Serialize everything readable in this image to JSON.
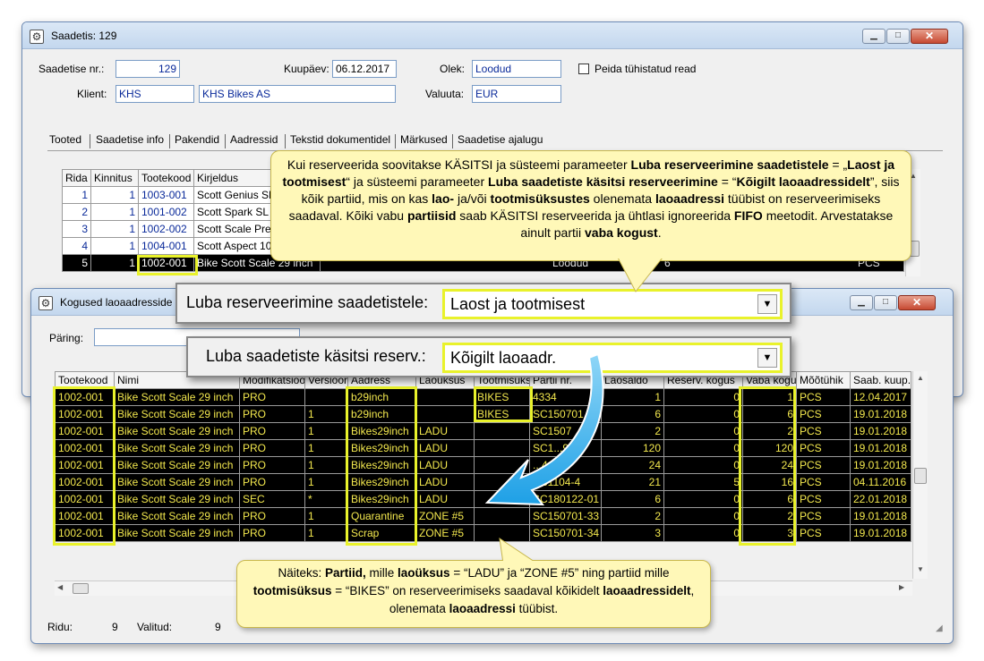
{
  "win1": {
    "title": "Saadetis: 129",
    "btn_min": "▁",
    "btn_max": "□",
    "btn_close": "✕",
    "fields": {
      "shipment_label": "Saadetise nr.:",
      "shipment_value": "129",
      "date_label": "Kuupäev:",
      "date_value": "06.12.2017",
      "state_label": "Olek:",
      "state_value": "Loodud",
      "hide_label": "Peida tühistatud read",
      "client_label": "Klient:",
      "client_code": "KHS",
      "client_name": "KHS Bikes AS",
      "currency_label": "Valuuta:",
      "currency_value": "EUR"
    },
    "tabs": [
      "Tooted",
      "Saadetise info",
      "Pakendid",
      "Aadressid",
      "Tekstid dokumentidel",
      "Märkused",
      "Saadetise ajalugu"
    ],
    "table": {
      "headers": [
        "Rida",
        "Kinnitus",
        "Tootekood",
        "Kirjeldus"
      ],
      "rows": [
        [
          "1",
          "1",
          "1003-001",
          "Scott Genius SL"
        ],
        [
          "2",
          "1",
          "1001-002",
          "Scott Spark SL"
        ],
        [
          "3",
          "1",
          "1002-002",
          "Scott Scale Pre"
        ],
        [
          "4",
          "1",
          "1004-001",
          "Scott Aspect 10"
        ],
        [
          "5",
          "1",
          "1002-001",
          "Bike Scott Scale 29 inch"
        ]
      ],
      "selected_tail": {
        "state": "Loodud",
        "qty": "6",
        "unit": "PCS"
      }
    }
  },
  "win2": {
    "title": "Kogused laoaadresside",
    "query_label": "Päring:",
    "table": {
      "headers": [
        "Tootekood",
        "Nimi",
        "Modifikatsioo",
        "Versioon",
        "Aadress",
        "Laoüksus",
        "Tootmisüks",
        "Partii nr.",
        "Laosaldo",
        "Reserv. kogus",
        "Vaba kogu",
        "Mõõtühik",
        "Saab. kuup."
      ],
      "rows": [
        [
          "1002-001",
          "Bike Scott Scale 29 inch",
          "PRO",
          "",
          "b29inch",
          "",
          "BIKES",
          "4334",
          "1",
          "0",
          "1",
          "PCS",
          "12.04.2017"
        ],
        [
          "1002-001",
          "Bike Scott Scale 29 inch",
          "PRO",
          "1",
          "b29inch",
          "",
          "BIKES",
          "SC150701",
          "6",
          "0",
          "6",
          "PCS",
          "19.01.2018"
        ],
        [
          "1002-001",
          "Bike Scott Scale 29 inch",
          "PRO",
          "1",
          "Bikes29inch",
          "LADU",
          "",
          "SC1507",
          "2",
          "0",
          "2",
          "PCS",
          "19.01.2018"
        ],
        [
          "1002-001",
          "Bike Scott Scale 29 inch",
          "PRO",
          "1",
          "Bikes29inch",
          "LADU",
          "",
          "SC1...9",
          "120",
          "0",
          "120",
          "PCS",
          "19.01.2018"
        ],
        [
          "1002-001",
          "Bike Scott Scale 29 inch",
          "PRO",
          "1",
          "Bikes29inch",
          "LADU",
          "",
          "...4-15",
          "24",
          "0",
          "24",
          "PCS",
          "19.01.2018"
        ],
        [
          "1002-001",
          "Bike Scott Scale 29 inch",
          "PRO",
          "1",
          "Bikes29inch",
          "LADU",
          "",
          "...61104-4",
          "21",
          "5",
          "16",
          "PCS",
          "04.11.2016"
        ],
        [
          "1002-001",
          "Bike Scott Scale 29 inch",
          "SEC",
          "*",
          "Bikes29inch",
          "LADU",
          "",
          "SC180122-01",
          "6",
          "0",
          "6",
          "PCS",
          "22.01.2018"
        ],
        [
          "1002-001",
          "Bike Scott Scale 29 inch",
          "PRO",
          "1",
          "Quarantine",
          "ZONE #5",
          "",
          "SC150701-33",
          "2",
          "0",
          "2",
          "PCS",
          "19.01.2018"
        ],
        [
          "1002-001",
          "Bike Scott Scale 29 inch",
          "PRO",
          "1",
          "Scrap",
          "ZONE #5",
          "",
          "SC150701-34",
          "3",
          "0",
          "3",
          "PCS",
          "19.01.2018"
        ]
      ]
    },
    "status": {
      "rows_label": "Ridu:",
      "rows_value": "9",
      "selected_label": "Valitud:",
      "selected_value": "9"
    }
  },
  "zoom1": {
    "label": "Luba reserveerimine saadetistele:",
    "value": "Laost ja tootmisest"
  },
  "zoom2": {
    "label": "Luba saadetiste käsitsi reserv.:",
    "value": "Kõigilt laoaadr."
  },
  "callout1": {
    "p1": "Kui reserveerida soovitakse KÄSITSI ja süsteemi parameeter ",
    "b1": "Luba reserveerimine saadetistele",
    "p2": " = „",
    "b2": "Laost ja tootmisest",
    "p3": "“ ja süsteemi parameeter ",
    "b3": "Luba saadetiste käsitsi reserveerimine",
    "p4": " = “",
    "b4": "Kõigilt laoaadressidelt",
    "p5": "”, siis kõik partiid, mis on kas ",
    "b5": "lao-",
    "p6": " ja/või ",
    "b6": "tootmisüksustes",
    "p7": " olenemata ",
    "b7": "laoaadressi",
    "p8": " tüübist on reserveerimiseks saadaval. Kõiki vabu ",
    "b8": "partiisid",
    "p9": " saab KÄSITSI reserveerida ja ühtlasi ignoreerida ",
    "b9": "FIFO",
    "p10": " meetodit. Arvestatakse ainult partii ",
    "b10": "vaba kogust",
    "p11": "."
  },
  "callout2": {
    "p1": "Näiteks: ",
    "b1": "Partiid,",
    "p2": " mille ",
    "b2": "laoüksus",
    "p3": " = “LADU” ja “ZONE #5” ning partiid mille ",
    "b3": "tootmisüksus",
    "p4": " = “BIKES” on reserveerimiseks saadaval kõikidelt ",
    "b4": "laoaadressidelt",
    "p5": ", olenemata ",
    "b5": "laoaadressi",
    "p6": " tüübist."
  },
  "colors": {
    "highlight": "#e9f22b",
    "callout": "#fff8b8",
    "arrow": "#1ea0e6"
  }
}
